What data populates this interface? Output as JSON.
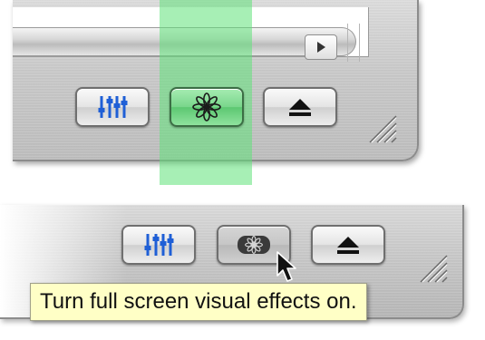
{
  "top_panel": {
    "buttons": [
      {
        "name": "equalizer",
        "icon": "equalizer-icon",
        "state": "normal"
      },
      {
        "name": "visualizer",
        "icon": "visualizer-flower-icon",
        "state": "active"
      },
      {
        "name": "eject",
        "icon": "eject-icon",
        "state": "normal"
      }
    ],
    "highlight_color": "#5FE278",
    "accent_blue": "#1f5fd6"
  },
  "bottom_panel": {
    "buttons": [
      {
        "name": "equalizer",
        "icon": "equalizer-icon",
        "state": "normal"
      },
      {
        "name": "visualizer",
        "icon": "visualizer-flower-icon",
        "state": "pressed"
      },
      {
        "name": "eject",
        "icon": "eject-icon",
        "state": "normal"
      }
    ],
    "tooltip": {
      "text": "Turn full screen visual effects on."
    },
    "cursor_icon": "arrow-cursor-icon"
  }
}
